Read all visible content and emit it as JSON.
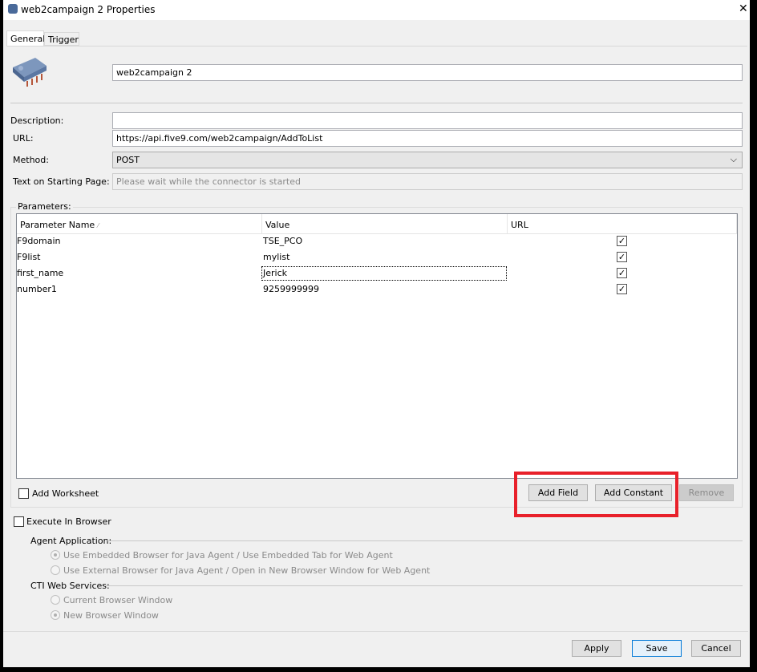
{
  "window": {
    "title": "web2campaign 2 Properties",
    "close": "✕"
  },
  "tabs": [
    {
      "label": "General",
      "active": true
    },
    {
      "label": "Trigger",
      "active": false
    }
  ],
  "general": {
    "name_value": "web2campaign 2",
    "description_label": "Description:",
    "description_value": "",
    "url_label": "URL:",
    "url_value": "https://api.five9.com/web2campaign/AddToList",
    "method_label": "Method:",
    "method_value": "POST",
    "starting_page_label": "Text on Starting Page:",
    "starting_page_placeholder": "Please wait while the connector is started"
  },
  "parameters": {
    "label": "Parameters:",
    "columns": [
      "Parameter Name",
      "Value",
      "URL"
    ],
    "rows": [
      {
        "name": "F9domain",
        "value": "TSE_PCO",
        "url": true
      },
      {
        "name": "F9list",
        "value": "mylist",
        "url": true
      },
      {
        "name": "first_name",
        "value": "Jerick",
        "url": true
      },
      {
        "name": "number1",
        "value": "9259999999",
        "url": true
      }
    ],
    "add_worksheet_label": "Add Worksheet",
    "add_worksheet_checked": false,
    "add_field": "Add Field",
    "add_constant": "Add Constant",
    "remove": "Remove",
    "highlight_color": "#e8202a"
  },
  "browser": {
    "execute_label": "Execute In Browser",
    "execute_checked": false,
    "agent_app_label": "Agent Application:",
    "agent_opts": [
      "Use Embedded Browser for Java Agent / Use Embedded Tab for Web Agent",
      "Use External Browser for Java Agent / Open in New Browser Window for Web Agent"
    ],
    "cti_label": "CTI Web Services:",
    "cti_opts": [
      "Current Browser Window",
      "New Browser Window"
    ]
  },
  "footer": {
    "apply": "Apply",
    "save": "Save",
    "cancel": "Cancel"
  }
}
